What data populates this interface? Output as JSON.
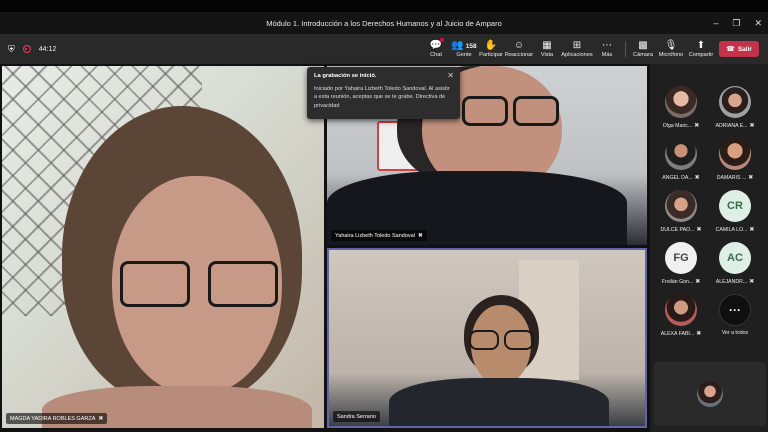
{
  "window": {
    "title": "Módulo 1. Introducción a los Derechos Humanos y al Juicio de Amparo",
    "minimize_icon": "minimize-icon",
    "restore_icon": "restore-icon",
    "close_icon": "close-icon"
  },
  "toolbar": {
    "timer": "44:12",
    "chat_label": "Chat",
    "people_label": "Gente",
    "people_count": "158",
    "raise_label": "Participar",
    "react_label": "Reaccionar",
    "view_label": "Vista",
    "apps_label": "Aplicaciones",
    "more_label": "Más",
    "camera_label": "Cámara",
    "mic_label": "Micrófono",
    "share_label": "Compartir",
    "leave_label": "Salir"
  },
  "toast": {
    "title": "La grabación se inició.",
    "body": "Iniciado por Yahaira Lizbeth Toledo Sandoval. Al asistir a esta reunión, aceptas que se te grabe. Directiva de privacidad"
  },
  "tiles": [
    {
      "name": "MAGDA YADIRA ROBLES GARZA"
    },
    {
      "name": "Yahaira Lizbeth Toledo Sandoval"
    },
    {
      "name": "Sandra Serrano"
    }
  ],
  "roster": [
    {
      "name": "Olga Maric...",
      "initials": ""
    },
    {
      "name": "ADRIANA E...",
      "initials": ""
    },
    {
      "name": "ANGEL DA...",
      "initials": ""
    },
    {
      "name": "DAMARIS ...",
      "initials": ""
    },
    {
      "name": "DULCE PAO...",
      "initials": ""
    },
    {
      "name": "CAMILA LO...",
      "initials": "CR"
    },
    {
      "name": "Froilán Gon...",
      "initials": "FG"
    },
    {
      "name": "ALEJANDR...",
      "initials": "AC"
    },
    {
      "name": "ALEXA FABI...",
      "initials": ""
    },
    {
      "name": "Ver a todos",
      "initials": "···"
    }
  ]
}
